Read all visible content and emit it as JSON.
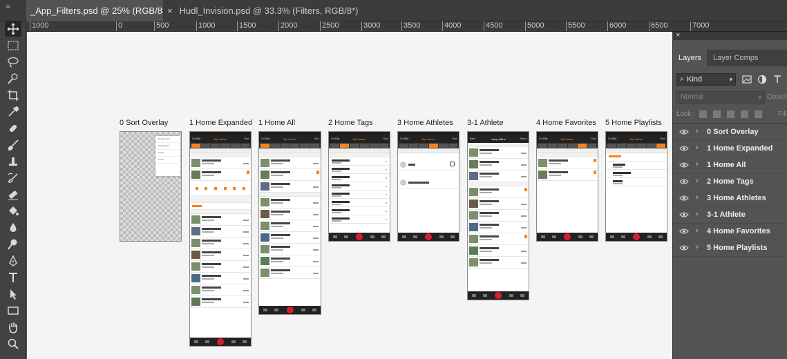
{
  "app": {
    "tabs": [
      {
        "label": "_App_Filters.psd @ 25% (RGB/8#) *",
        "active": true
      },
      {
        "label": "Hudl_Invision.psd @ 33.3% (Filters, RGB/8*)",
        "active": false
      }
    ],
    "collapse_glyph": "»",
    "close_glyph": "×"
  },
  "ruler": {
    "labels": [
      "1000",
      "0",
      "500",
      "1000",
      "1500",
      "2000",
      "2500",
      "3000",
      "3500",
      "4000",
      "4500",
      "5000",
      "5500",
      "6000",
      "6500",
      "7000"
    ]
  },
  "artboards": [
    {
      "label": "0 Sort Overlay",
      "kind": "overlay",
      "popup_items": [
        "Newest First",
        "Oldest First",
        "A to Z",
        "Z to A"
      ]
    },
    {
      "label": "1 Home Expanded",
      "kind": "list",
      "nav_title": "My Videos",
      "nav_left": "Go Elite",
      "nav_right": "Sort"
    },
    {
      "label": "1 Home All",
      "kind": "list",
      "nav_title": "My Videos",
      "nav_left": "Go Elite",
      "nav_right": "Sort"
    },
    {
      "label": "2 Home Tags",
      "kind": "tags",
      "nav_title": "My Videos",
      "nav_left": "Go Elite",
      "nav_right": "Sort"
    },
    {
      "label": "3 Home Athletes",
      "kind": "athletes",
      "nav_title": "My Videos",
      "nav_left": "Go Elite",
      "nav_right": "Sort"
    },
    {
      "label": "3-1 Athlete",
      "kind": "list",
      "nav_title": "mary collins",
      "nav_left": "Back",
      "nav_right": "Select"
    },
    {
      "label": "4 Home Favorites",
      "kind": "favorites",
      "nav_title": "My Videos",
      "nav_left": "Go Elite",
      "nav_right": "Sort"
    },
    {
      "label": "5 Home Playlists",
      "kind": "playlists",
      "nav_title": "My Videos",
      "nav_left": "Go Elite",
      "nav_right": "Sort"
    }
  ],
  "layers_panel": {
    "close_glyph": "×",
    "tabs": [
      "Layers",
      "Layer Comps"
    ],
    "filter_kind": "Kind",
    "blend_mode": "Normal",
    "opacity_label": "Opacity",
    "lock_label": "Lock:",
    "fill_label": "Fill",
    "layers": [
      "0 Sort Overlay",
      "1 Home Expanded",
      "1 Home All",
      "2 Home Tags",
      "3 Home Athletes",
      "3-1 Athlete",
      "4 Home Favorites",
      "5 Home Playlists"
    ]
  },
  "tools": [
    "move-tool",
    "marquee-tool",
    "lasso-tool",
    "quick-select-tool",
    "crop-tool",
    "eyedropper-tool",
    "healing-brush-tool",
    "brush-tool",
    "clone-stamp-tool",
    "history-brush-tool",
    "eraser-tool",
    "paint-bucket-tool",
    "blur-tool",
    "dodge-tool",
    "pen-tool",
    "type-tool",
    "path-select-tool",
    "rectangle-tool",
    "hand-tool",
    "zoom-tool"
  ],
  "colors": {
    "accent": "#f58220",
    "record": "#d3202a",
    "panel": "#535353",
    "canvas": "#f4f4f4"
  }
}
